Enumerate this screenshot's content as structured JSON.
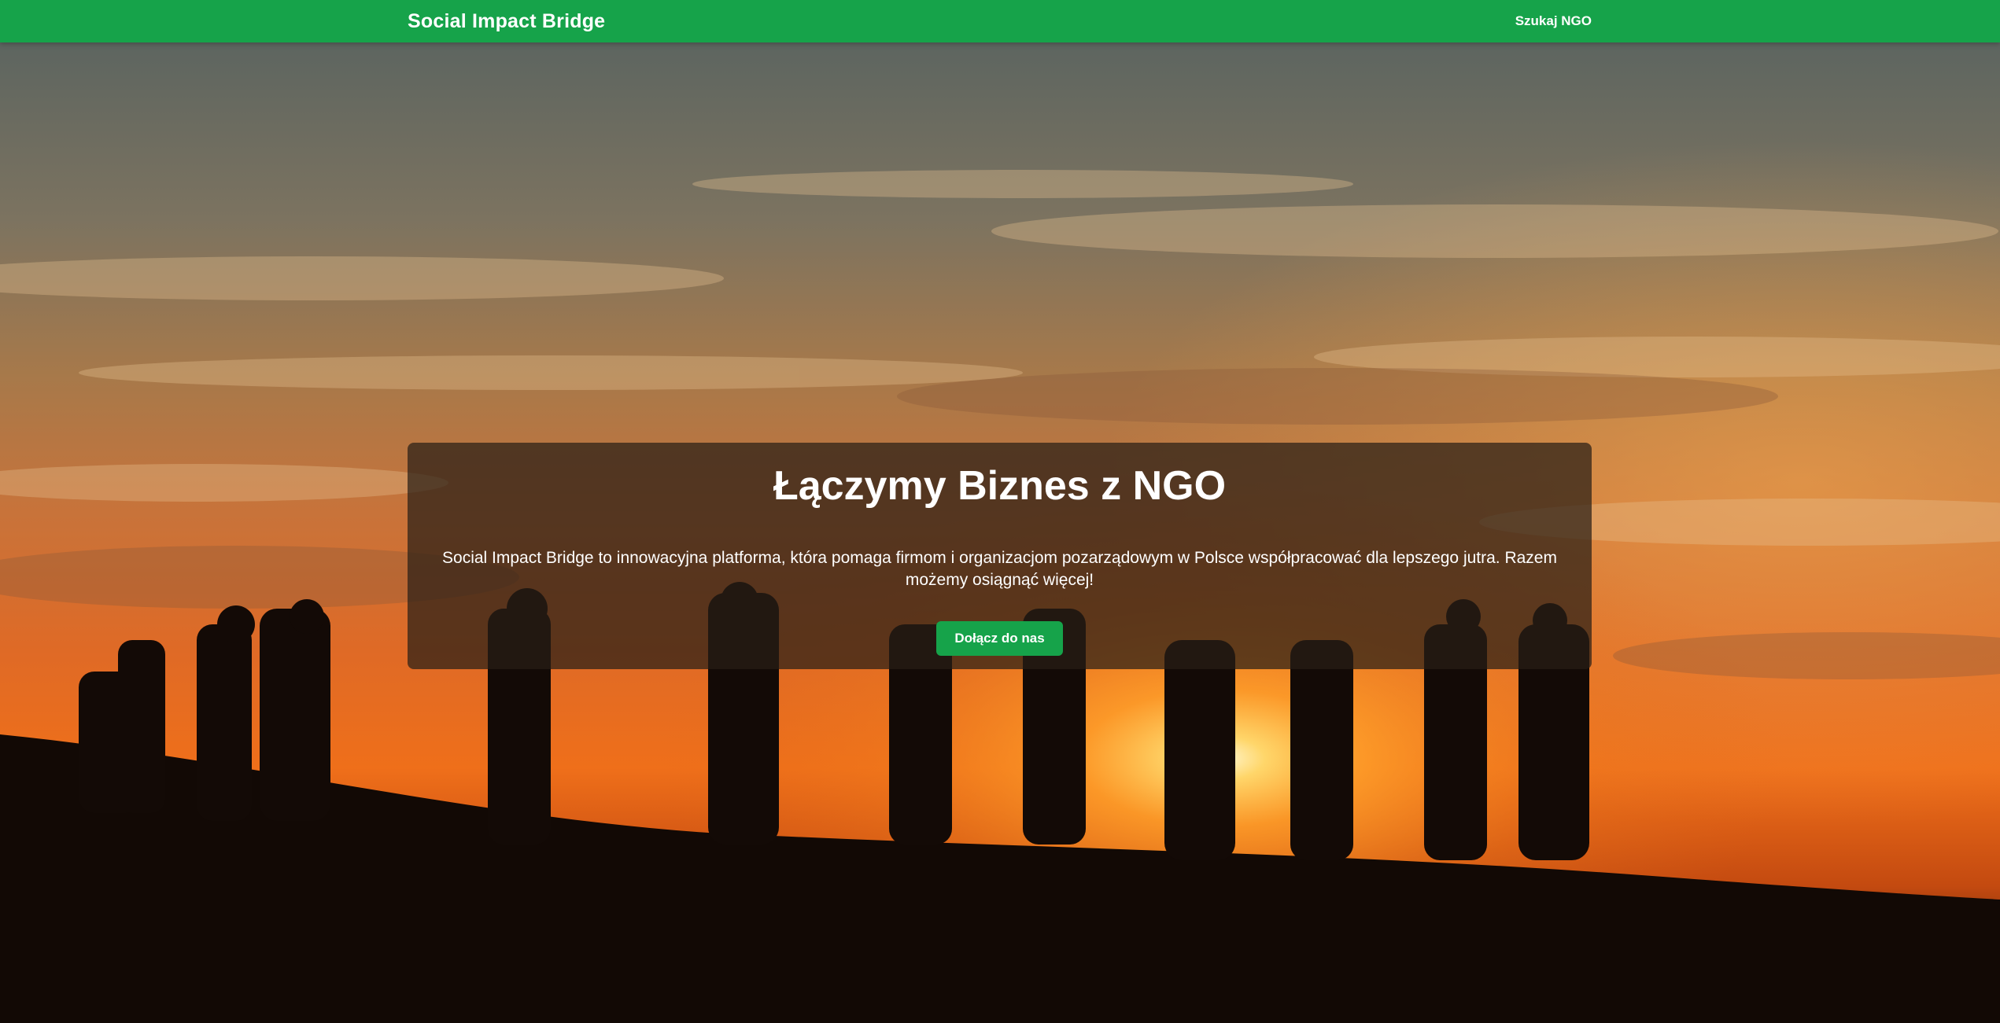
{
  "navbar": {
    "brand": "Social Impact Bridge",
    "links": [
      {
        "label": "Szukaj NGO"
      }
    ],
    "background_color": "#16a34a"
  },
  "hero": {
    "image": "silhouettes-of-people-on-hill-at-sunset",
    "title": "Łączymy Biznes z NGO",
    "description": "Social Impact Bridge to innowacyjna platforma, która pomaga firmom i organizacjom pozarządowym w Polsce współpracować dla lepszego jutra. Razem możemy osiągnąć więcej!",
    "cta_label": "Dołącz do nas",
    "cta_color": "#16a34a"
  }
}
